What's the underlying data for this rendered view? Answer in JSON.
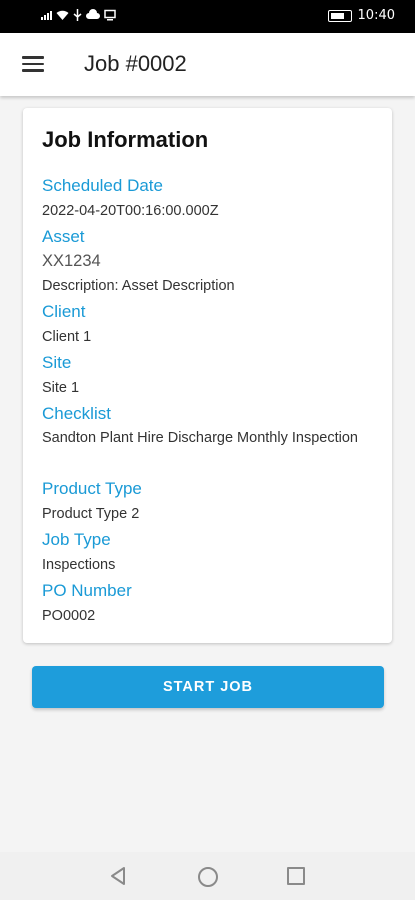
{
  "status_bar": {
    "time": "10:40",
    "icons": [
      "signal-icon",
      "wifi-icon",
      "usb-icon",
      "cloud-icon",
      "screen-icon",
      "battery-icon"
    ]
  },
  "app_bar": {
    "title": "Job #0002",
    "menu_icon": "hamburger-menu-icon"
  },
  "job_info": {
    "heading": "Job Information",
    "fields": [
      {
        "label": "Scheduled Date",
        "value": "2022-04-20T00:16:00.000Z"
      },
      {
        "label": "Asset",
        "value": "XX1234",
        "extra": "Description: Asset Description"
      },
      {
        "label": "Client",
        "value": "Client 1"
      },
      {
        "label": "Site",
        "value": "Site 1"
      },
      {
        "label": "Checklist",
        "value": "Sandton Plant Hire Discharge Monthly Inspection"
      },
      {
        "label": "Product Type",
        "value": "Product Type 2"
      },
      {
        "label": "Job Type",
        "value": "Inspections"
      },
      {
        "label": "PO Number",
        "value": "PO0002"
      }
    ]
  },
  "actions": {
    "start_label": "START JOB"
  },
  "colors": {
    "accent": "#1e9ddb",
    "label": "#1a9ad6",
    "status_bar": "#000000"
  },
  "nav_bar": {
    "icons": [
      "back-icon",
      "home-icon",
      "recent-apps-icon"
    ]
  }
}
